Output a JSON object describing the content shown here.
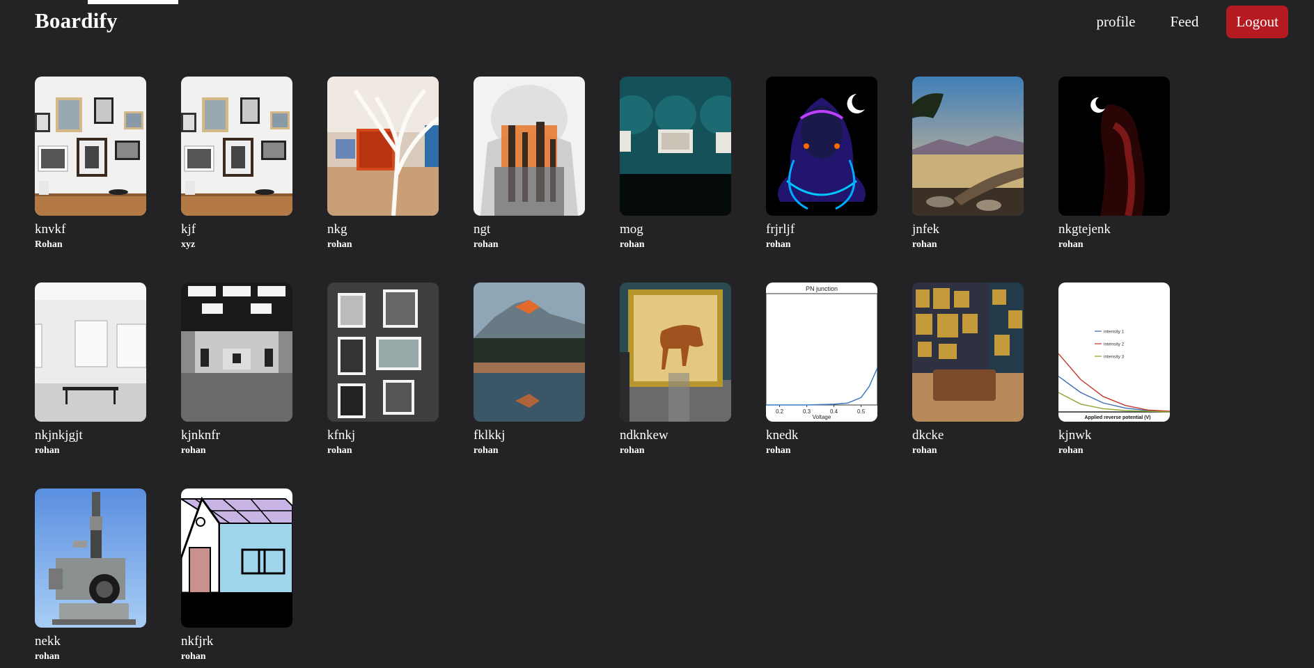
{
  "app": {
    "name": "Boardify"
  },
  "nav": {
    "profile": "profile",
    "feed": "Feed",
    "logout": "Logout"
  },
  "colors": {
    "background": "#232326",
    "logout": "#b51a20",
    "text": "#ffffff"
  },
  "pins": [
    {
      "title": "knvkf",
      "author": "Rohan",
      "image": "gallery-wall-white"
    },
    {
      "title": "kjf",
      "author": "xyz",
      "image": "gallery-wall-white"
    },
    {
      "title": "nkg",
      "author": "rohan",
      "image": "white-tree-installation"
    },
    {
      "title": "ngt",
      "author": "rohan",
      "image": "worker-refinery-double-exposure"
    },
    {
      "title": "mog",
      "author": "rohan",
      "image": "teal-gallery-room"
    },
    {
      "title": "frjrljf",
      "author": "rohan",
      "image": "neon-shiva"
    },
    {
      "title": "jnfek",
      "author": "rohan",
      "image": "lake-sunset"
    },
    {
      "title": "nkgtejenk",
      "author": "rohan",
      "image": "dark-shiva"
    },
    {
      "title": "nkjnkjgjt",
      "author": "rohan",
      "image": "empty-white-gallery"
    },
    {
      "title": "kjnknfr",
      "author": "rohan",
      "image": "grey-gallery-hall"
    },
    {
      "title": "kfnkj",
      "author": "rohan",
      "image": "black-white-frames"
    },
    {
      "title": "fklkkj",
      "author": "rohan",
      "image": "mountain-reflection"
    },
    {
      "title": "ndknkew",
      "author": "rohan",
      "image": "horse-painting-museum"
    },
    {
      "title": "knedk",
      "author": "rohan",
      "image": "pn-junction-chart",
      "chart_data": {
        "type": "line",
        "title": "PN junction",
        "xlabel": "Voltage",
        "ylabel": "",
        "x_ticks": [
          0.2,
          0.3,
          0.4,
          0.5
        ],
        "xlim": [
          0.15,
          0.56
        ],
        "series": [
          {
            "x": [
              0.15,
              0.3,
              0.4,
              0.45,
              0.5,
              0.53,
              0.56
            ],
            "y": [
              0,
              0,
              0.002,
              0.005,
              0.02,
              0.05,
              0.1
            ]
          }
        ]
      }
    },
    {
      "title": "dkcke",
      "author": "rohan",
      "image": "salon-gallery-sofa"
    },
    {
      "title": "kjnwk",
      "author": "rohan",
      "image": "intensity-chart",
      "chart_data": {
        "type": "line",
        "title": "",
        "xlabel": "Applied reverse potential (V)",
        "ylabel": "",
        "legend_position": "top-center",
        "series": [
          {
            "name": "intensity 1",
            "color": "#3b6fb5",
            "x": [
              0,
              0.2,
              0.4,
              0.6,
              0.8,
              1
            ],
            "y": [
              0.55,
              0.3,
              0.14,
              0.06,
              0.02,
              0.01
            ]
          },
          {
            "name": "intensity 2",
            "color": "#c0392b",
            "x": [
              0,
              0.2,
              0.4,
              0.6,
              0.8,
              1
            ],
            "y": [
              0.9,
              0.5,
              0.24,
              0.1,
              0.03,
              0.01
            ]
          },
          {
            "name": "intensity 3",
            "color": "#8aa832",
            "x": [
              0,
              0.2,
              0.4,
              0.6,
              0.8,
              1
            ],
            "y": [
              0.3,
              0.12,
              0.05,
              0.02,
              0.01,
              0.0
            ]
          }
        ]
      }
    },
    {
      "title": "nekk",
      "author": "rohan",
      "image": "microscope"
    },
    {
      "title": "nkfjrk",
      "author": "rohan",
      "image": "house-drawing"
    }
  ]
}
